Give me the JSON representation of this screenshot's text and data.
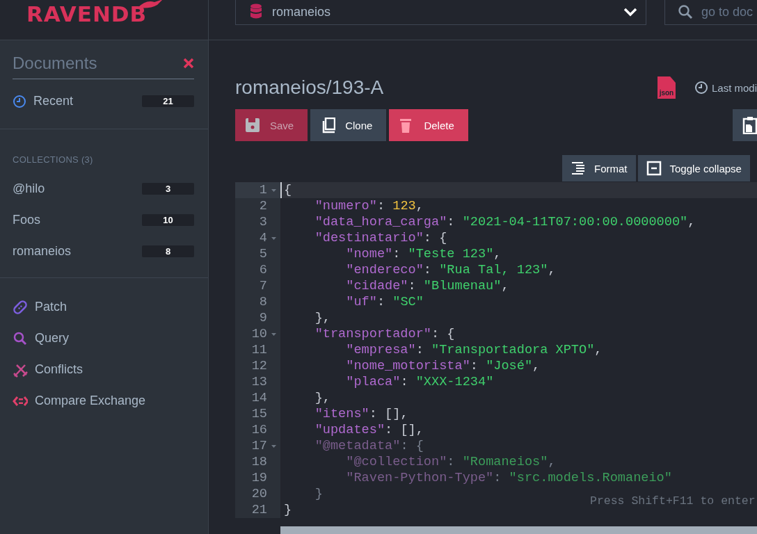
{
  "logo": {
    "text": "RAVENDB"
  },
  "topbar": {
    "database": "romaneios",
    "search": {
      "placeholder": "go to doc"
    }
  },
  "sidebar": {
    "title": "Documents",
    "recent": {
      "label": "Recent",
      "count": "21"
    },
    "collections_heading": "COLLECTIONS (3)",
    "collections": [
      {
        "label": "@hilo",
        "count": "3"
      },
      {
        "label": "Foos",
        "count": "10"
      },
      {
        "label": "romaneios",
        "count": "8"
      }
    ],
    "tools": [
      {
        "label": "Patch",
        "color": "#7d5fe0"
      },
      {
        "label": "Query",
        "color": "#a552c8"
      },
      {
        "label": "Conflicts",
        "color": "#c84a8e"
      },
      {
        "label": "Compare Exchange",
        "color": "#e0406a"
      }
    ]
  },
  "document": {
    "title": "romaneios/193-A",
    "file_type": "json",
    "last_modified": "Last modi",
    "buttons": [
      {
        "label": "Save",
        "kind": "save",
        "disabled": true
      },
      {
        "label": "Clone",
        "kind": "clone",
        "disabled": false
      },
      {
        "label": "Delete",
        "kind": "delete",
        "disabled": false
      }
    ],
    "editor_tools": [
      {
        "label": "Format",
        "kind": "format"
      },
      {
        "label": "Toggle collapse",
        "kind": "toggle"
      }
    ]
  },
  "editor": {
    "hint": "Press Shift+F11 to enter",
    "lines": [
      {
        "number": "1",
        "foldable": true,
        "active": true,
        "tokens": [
          {
            "kind": "punct",
            "text": "{"
          }
        ]
      },
      {
        "number": "2",
        "foldable": false,
        "active": false,
        "tokens": [
          {
            "kind": "key",
            "text": "    \"numero\""
          },
          {
            "kind": "punct",
            "text": ": "
          },
          {
            "kind": "number",
            "text": "123"
          },
          {
            "kind": "punct",
            "text": ","
          }
        ]
      },
      {
        "number": "3",
        "foldable": false,
        "active": false,
        "tokens": [
          {
            "kind": "key",
            "text": "    \"data_hora_carga\""
          },
          {
            "kind": "punct",
            "text": ": "
          },
          {
            "kind": "string",
            "text": "\"2021-04-11T07:00:00.0000000\""
          },
          {
            "kind": "punct",
            "text": ","
          }
        ]
      },
      {
        "number": "4",
        "foldable": true,
        "active": false,
        "tokens": [
          {
            "kind": "key",
            "text": "    \"destinatario\""
          },
          {
            "kind": "punct",
            "text": ": {"
          }
        ]
      },
      {
        "number": "5",
        "foldable": false,
        "active": false,
        "tokens": [
          {
            "kind": "key",
            "text": "        \"nome\""
          },
          {
            "kind": "punct",
            "text": ": "
          },
          {
            "kind": "string",
            "text": "\"Teste 123\""
          },
          {
            "kind": "punct",
            "text": ","
          }
        ]
      },
      {
        "number": "6",
        "foldable": false,
        "active": false,
        "tokens": [
          {
            "kind": "key",
            "text": "        \"endereco\""
          },
          {
            "kind": "punct",
            "text": ": "
          },
          {
            "kind": "string",
            "text": "\"Rua Tal, 123\""
          },
          {
            "kind": "punct",
            "text": ","
          }
        ]
      },
      {
        "number": "7",
        "foldable": false,
        "active": false,
        "tokens": [
          {
            "kind": "key",
            "text": "        \"cidade\""
          },
          {
            "kind": "punct",
            "text": ": "
          },
          {
            "kind": "string",
            "text": "\"Blumenau\""
          },
          {
            "kind": "punct",
            "text": ","
          }
        ]
      },
      {
        "number": "8",
        "foldable": false,
        "active": false,
        "tokens": [
          {
            "kind": "key",
            "text": "        \"uf\""
          },
          {
            "kind": "punct",
            "text": ": "
          },
          {
            "kind": "string",
            "text": "\"SC\""
          }
        ]
      },
      {
        "number": "9",
        "foldable": false,
        "active": false,
        "tokens": [
          {
            "kind": "punct",
            "text": "    },"
          }
        ]
      },
      {
        "number": "10",
        "foldable": true,
        "active": false,
        "tokens": [
          {
            "kind": "key",
            "text": "    \"transportador\""
          },
          {
            "kind": "punct",
            "text": ": {"
          }
        ]
      },
      {
        "number": "11",
        "foldable": false,
        "active": false,
        "tokens": [
          {
            "kind": "key",
            "text": "        \"empresa\""
          },
          {
            "kind": "punct",
            "text": ": "
          },
          {
            "kind": "string",
            "text": "\"Transportadora XPTO\""
          },
          {
            "kind": "punct",
            "text": ","
          }
        ]
      },
      {
        "number": "12",
        "foldable": false,
        "active": false,
        "tokens": [
          {
            "kind": "key",
            "text": "        \"nome_motorista\""
          },
          {
            "kind": "punct",
            "text": ": "
          },
          {
            "kind": "string",
            "text": "\"José\""
          },
          {
            "kind": "punct",
            "text": ","
          }
        ]
      },
      {
        "number": "13",
        "foldable": false,
        "active": false,
        "tokens": [
          {
            "kind": "key",
            "text": "        \"placa\""
          },
          {
            "kind": "punct",
            "text": ": "
          },
          {
            "kind": "string",
            "text": "\"XXX-1234\""
          }
        ]
      },
      {
        "number": "14",
        "foldable": false,
        "active": false,
        "tokens": [
          {
            "kind": "punct",
            "text": "    },"
          }
        ]
      },
      {
        "number": "15",
        "foldable": false,
        "active": false,
        "tokens": [
          {
            "kind": "key",
            "text": "    \"itens\""
          },
          {
            "kind": "punct",
            "text": ": [],"
          }
        ]
      },
      {
        "number": "16",
        "foldable": false,
        "active": false,
        "tokens": [
          {
            "kind": "key",
            "text": "    \"updates\""
          },
          {
            "kind": "punct",
            "text": ": [],"
          }
        ]
      },
      {
        "number": "17",
        "foldable": true,
        "active": false,
        "tokens": [
          {
            "kind": "meta-key",
            "text": "    \"@metadata\""
          },
          {
            "kind": "meta-punct",
            "text": ": {"
          }
        ]
      },
      {
        "number": "18",
        "foldable": false,
        "active": false,
        "tokens": [
          {
            "kind": "meta-key",
            "text": "        \"@collection\""
          },
          {
            "kind": "meta-punct",
            "text": ": "
          },
          {
            "kind": "meta-string",
            "text": "\"Romaneios\""
          },
          {
            "kind": "meta-punct",
            "text": ","
          }
        ]
      },
      {
        "number": "19",
        "foldable": false,
        "active": false,
        "tokens": [
          {
            "kind": "meta-key",
            "text": "        \"Raven-Python-Type\""
          },
          {
            "kind": "meta-punct",
            "text": ": "
          },
          {
            "kind": "meta-string",
            "text": "\"src.models.Romaneio\""
          }
        ]
      },
      {
        "number": "20",
        "foldable": false,
        "active": false,
        "tokens": [
          {
            "kind": "meta-punct",
            "text": "    }"
          }
        ]
      },
      {
        "number": "21",
        "foldable": false,
        "active": false,
        "tokens": [
          {
            "kind": "punct",
            "text": "}"
          }
        ]
      }
    ]
  }
}
